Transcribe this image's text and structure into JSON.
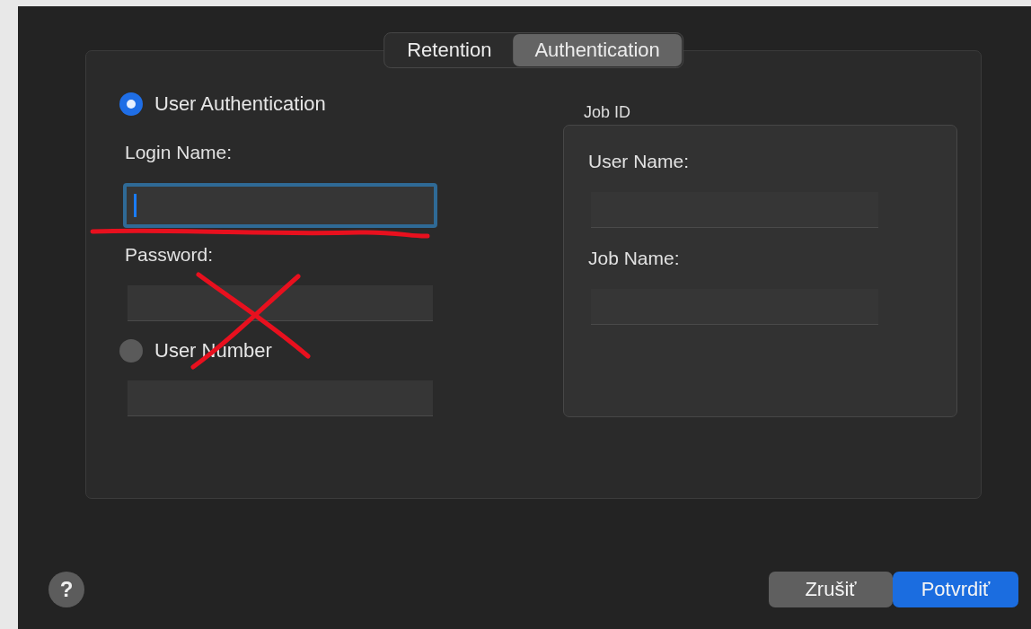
{
  "tabs": [
    {
      "label": "Retention",
      "selected": false
    },
    {
      "label": "Authentication",
      "selected": true
    }
  ],
  "auth_options": [
    {
      "label": "User Authentication",
      "selected": true,
      "fields": [
        {
          "label": "Login Name:",
          "focused": true
        },
        {
          "label": "Password:",
          "focused": false
        }
      ]
    },
    {
      "label": "User Number",
      "selected": false,
      "fields": [
        {
          "focused": false
        }
      ]
    }
  ],
  "job_id": {
    "title": "Job ID",
    "fields": [
      {
        "label": "User Name:",
        "focused": false
      },
      {
        "label": "Job Name:",
        "focused": false
      }
    ]
  },
  "help": {
    "label": "?"
  },
  "buttons": [
    {
      "label": "Zrušiť",
      "kind": "secondary"
    },
    {
      "label": "Potvrdiť",
      "kind": "primary"
    }
  ]
}
